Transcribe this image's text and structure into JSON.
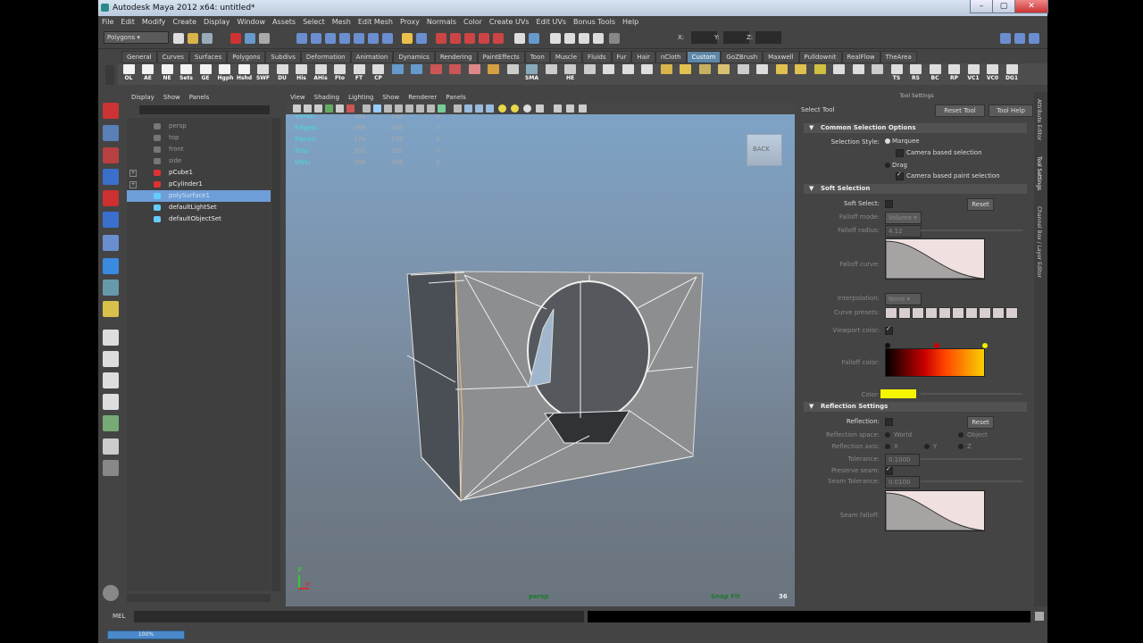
{
  "window": {
    "title": "Autodesk Maya 2012 x64: untitled*",
    "controls": [
      "–",
      "▢",
      "✕"
    ]
  },
  "menu": [
    "File",
    "Edit",
    "Modify",
    "Create",
    "Display",
    "Window",
    "Assets",
    "Select",
    "Mesh",
    "Edit Mesh",
    "Proxy",
    "Normals",
    "Color",
    "Create UVs",
    "Edit UVs",
    "Bonus Tools",
    "Help"
  ],
  "status_line": {
    "menu_set": "Polygons",
    "x_label": "X:",
    "y_label": "Y:",
    "z_label": "Z:"
  },
  "shelf_tabs": [
    "General",
    "Curves",
    "Surfaces",
    "Polygons",
    "Subdivs",
    "Deformation",
    "Animation",
    "Dynamics",
    "Rendering",
    "PaintEffects",
    "Toon",
    "Muscle",
    "Fluids",
    "Fur",
    "Hair",
    "nCloth",
    "Custom",
    "GoZBrush",
    "Maxwell",
    "Pulldownit",
    "RealFlow",
    "TheArea"
  ],
  "shelf_active": "Custom",
  "shelf_buttons": [
    "OL",
    "AE",
    "NE",
    "Sets",
    "GE",
    "Hgph",
    "Hshd",
    "SWF",
    "DU",
    "His",
    "AHis",
    "Fto",
    "FT",
    "CP",
    "",
    "",
    "",
    "",
    "",
    "",
    "",
    "SMA",
    "",
    "HE",
    "",
    "",
    "",
    "",
    "",
    "",
    "",
    "",
    "",
    "",
    "",
    "",
    "",
    "",
    "",
    "",
    "TS",
    "RS",
    "BC",
    "RP",
    "VC1",
    "VC0",
    "DG1"
  ],
  "outliner": {
    "menu": [
      "Display",
      "Show",
      "Panels"
    ],
    "items": [
      {
        "label": "persp",
        "dim": true,
        "expand": false
      },
      {
        "label": "top",
        "dim": true,
        "expand": false
      },
      {
        "label": "front",
        "dim": true,
        "expand": false
      },
      {
        "label": "side",
        "dim": true,
        "expand": false
      },
      {
        "label": "pCube1",
        "dim": false,
        "expand": true
      },
      {
        "label": "pCylinder1",
        "dim": false,
        "expand": true
      },
      {
        "label": "polySurface1",
        "dim": false,
        "expand": false,
        "selected": true
      },
      {
        "label": "defaultLightSet",
        "dim": false,
        "expand": false
      },
      {
        "label": "defaultObjectSet",
        "dim": false,
        "expand": false
      }
    ]
  },
  "viewport": {
    "menu": [
      "View",
      "Shading",
      "Lighting",
      "Show",
      "Renderer",
      "Panels"
    ],
    "hud": [
      {
        "label": "Verts:",
        "v1": "192",
        "v2": "192",
        "v3": "0"
      },
      {
        "label": "Edges:",
        "v1": "368",
        "v2": "288",
        "v3": "7"
      },
      {
        "label": "Faces:",
        "v1": "176",
        "v2": "176",
        "v3": "0"
      },
      {
        "label": "Tris:",
        "v1": "352",
        "v2": "352",
        "v3": "0"
      },
      {
        "label": "UVs:",
        "v1": "388",
        "v2": "388",
        "v3": "0"
      }
    ],
    "viewcube_label": "BACK",
    "camera_label": "persp",
    "snap_label": "Snap Fit",
    "frame_number": "36",
    "axis_y": "y",
    "axis_x": "x"
  },
  "tool_settings": {
    "header": "Tool Settings",
    "tool_name": "Select Tool",
    "reset_tool": "Reset Tool",
    "tool_help": "Tool Help",
    "common": {
      "title": "Common Selection Options",
      "selection_style_label": "Selection Style:",
      "marquee": "Marquee",
      "camera_based_selection": "Camera based selection",
      "drag": "Drag",
      "camera_based_paint": "Camera based paint selection"
    },
    "soft": {
      "title": "Soft Selection",
      "soft_select_label": "Soft Select:",
      "reset": "Reset",
      "falloff_mode_label": "Falloff mode:",
      "falloff_mode_value": "Volume",
      "falloff_radius_label": "Falloff radius:",
      "falloff_radius_value": "4.12",
      "falloff_curve_label": "Falloff curve:",
      "interpolation_label": "Interpolation:",
      "interpolation_value": "None",
      "curve_presets_label": "Curve presets:",
      "viewport_color_label": "Viewport color:",
      "falloff_color_label": "Falloff color:",
      "color_label": "Color:"
    },
    "reflection": {
      "title": "Reflection Settings",
      "reflection_label": "Reflection:",
      "reset": "Reset",
      "space_label": "Reflection space:",
      "world": "World",
      "object": "Object",
      "axis_label": "Reflection axis:",
      "axis_x": "X",
      "axis_y": "Y",
      "axis_z": "Z",
      "tolerance_label": "Tolerance:",
      "tolerance_value": "0.1000",
      "preserve_seam_label": "Preserve seam:",
      "seam_tolerance_label": "Seam Tolerance:",
      "seam_tolerance_value": "0.0100",
      "seam_falloff_label": "Seam falloff:"
    }
  },
  "side_tabs": [
    "Attribute Editor",
    "Tool Settings",
    "Channel Box / Layer Editor"
  ],
  "command_line": {
    "label": "MEL"
  },
  "help_line": {
    "progress": "100%"
  },
  "colors": {
    "accent": "#5d87a8",
    "selection": "#6e9ed8",
    "hud": "#5ac8d6",
    "bg": "#444444"
  }
}
